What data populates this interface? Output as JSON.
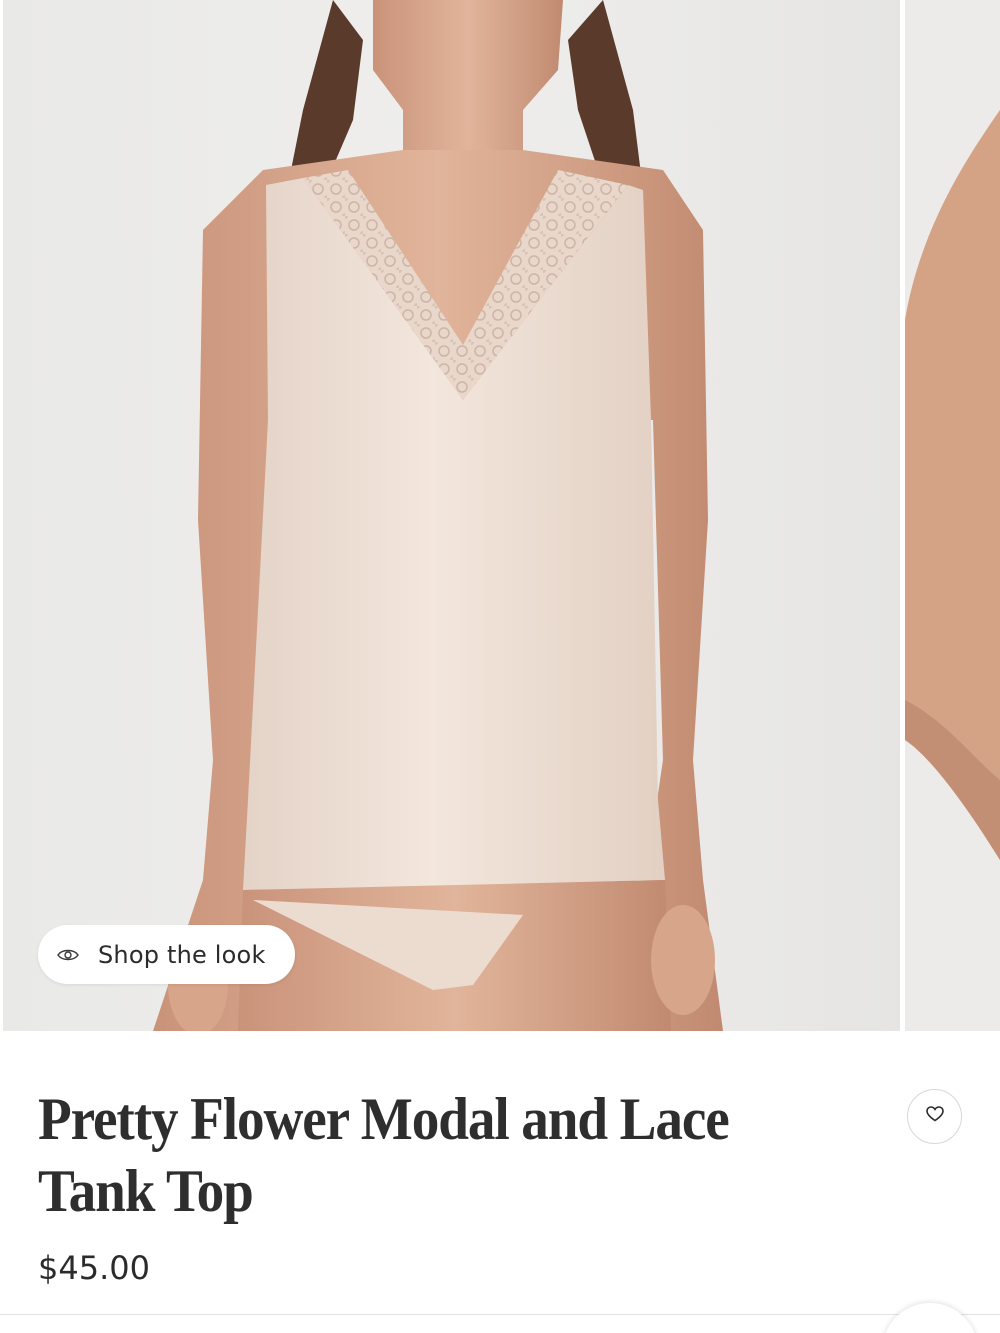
{
  "gallery": {
    "main_image_alt": "Model wearing the Pretty Flower Modal and Lace Tank Top",
    "next_image_alt": "Next product image",
    "shop_the_look": {
      "label": "Shop the look",
      "icon": "eye-icon"
    }
  },
  "product": {
    "title": "Pretty Flower Modal and Lace Tank Top",
    "price": "$45.00",
    "wishlist_icon": "heart-icon"
  },
  "colors": {
    "background": "#ffffff",
    "wall": "#ececea",
    "garment": "#eedfd4",
    "skin": "#d8a98a",
    "text": "#2e2e2e"
  }
}
